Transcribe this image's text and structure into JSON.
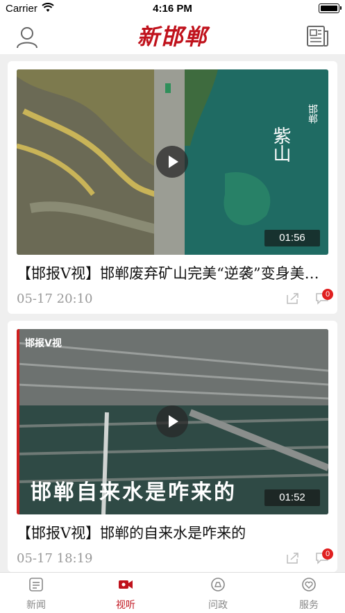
{
  "status_bar": {
    "carrier": "Carrier",
    "time": "4:16 PM"
  },
  "header": {
    "logo_text": "新邯郸"
  },
  "feed": [
    {
      "title": "【邯报V视】邯郸废弃矿山完美“逆袭”变身美丽风景",
      "date": "05-17  20:10",
      "duration": "01:56",
      "comment_count": "0",
      "overlay_text_right": "邯郸",
      "overlay_text_big": "紫山"
    },
    {
      "title": "【邯报V视】邯郸的自来水是咋来的",
      "date": "05-17  18:19",
      "duration": "01:52",
      "comment_count": "0",
      "overlay_tag": "邯报V视",
      "overlay_caption": "邯郸自来水是咋来的"
    }
  ],
  "tabbar": {
    "tabs": [
      {
        "label": "新闻",
        "icon": "news-icon",
        "active": false
      },
      {
        "label": "视听",
        "icon": "video-icon",
        "active": true
      },
      {
        "label": "问政",
        "icon": "politics-icon",
        "active": false
      },
      {
        "label": "服务",
        "icon": "service-icon",
        "active": false
      }
    ]
  },
  "colors": {
    "brand_red": "#c0121c",
    "badge_red": "#e02020",
    "muted_text": "#999999"
  }
}
